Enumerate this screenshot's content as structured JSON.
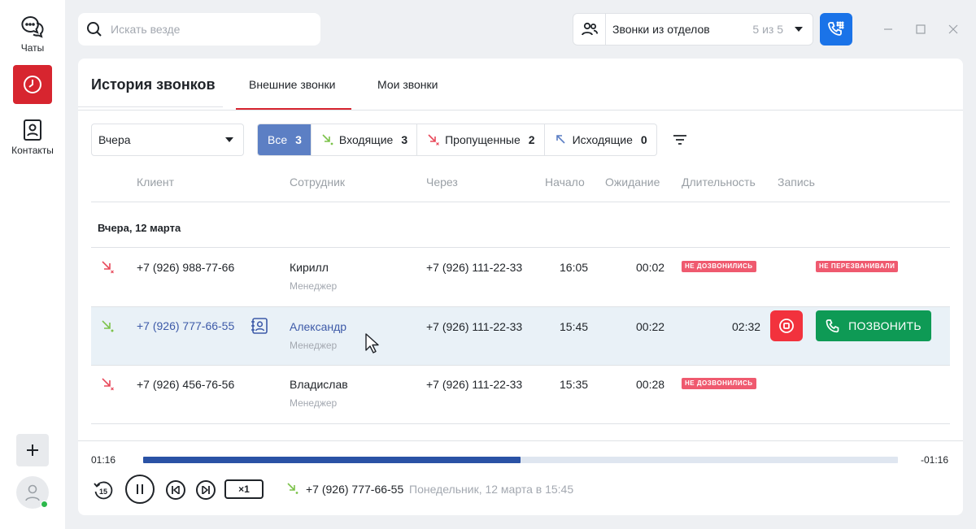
{
  "rail": {
    "chats_label": "Чаты",
    "contacts_label": "Контакты"
  },
  "search": {
    "placeholder": "Искать везде"
  },
  "departments": {
    "label": "Звонки из отделов",
    "count": "5 из 5"
  },
  "page": {
    "title": "История звонков",
    "tabs": [
      {
        "label": "Внешние звонки",
        "active": true
      },
      {
        "label": "Мои звонки",
        "active": false
      }
    ]
  },
  "filters": {
    "period": "Вчера",
    "types": [
      {
        "label": "Все",
        "count": "3",
        "active": true
      },
      {
        "label": "Входящие",
        "count": "3",
        "icon": "incoming-arrow-icon"
      },
      {
        "label": "Пропущенные",
        "count": "2",
        "icon": "missed-arrow-icon"
      },
      {
        "label": "Исходящие",
        "count": "0",
        "icon": "outgoing-arrow-icon"
      }
    ]
  },
  "table": {
    "headers": [
      "Клиент",
      "Сотрудник",
      "Через",
      "Начало",
      "Ожидание",
      "Длительность",
      "Запись"
    ],
    "group_label": "Вчера, 12 марта",
    "rows": [
      {
        "type": "missed",
        "client": "+7 (926) 988-77-66",
        "employee": "Кирилл",
        "role": "Менеджер",
        "via": "+7 (926) 111-22-33",
        "start": "16:05",
        "wait": "00:02",
        "duration_badge": "НЕ ДОЗВОНИЛИСЬ",
        "record_badge": "НЕ ПЕРЕЗВАНИВАЛИ"
      },
      {
        "type": "incoming",
        "client": "+7 (926) 777-66-55",
        "employee": "Александр",
        "role": "Менеджер",
        "via": "+7 (926) 111-22-33",
        "start": "15:45",
        "wait": "00:22",
        "duration": "02:32",
        "call_button": "ПОЗВОНИТЬ"
      },
      {
        "type": "missed",
        "client": "+7 (926) 456-76-56",
        "employee": "Владислав",
        "role": "Менеджер",
        "via": "+7 (926) 111-22-33",
        "start": "15:35",
        "wait": "00:28",
        "duration_badge": "НЕ ДОЗВОНИЛИСЬ"
      }
    ]
  },
  "player": {
    "elapsed": "01:16",
    "remaining": "-01:16",
    "progress": 0.5,
    "speed": "×1",
    "number": "+7 (926) 777-66-55",
    "date": "Понедельник, 12 марта в 15:45"
  },
  "colors": {
    "accent_red": "#d7252f",
    "blue": "#1a73e8",
    "green": "#0e9a55",
    "badge": "#ef5a6f",
    "filter_active": "#5c7fc4",
    "progress": "#2a52a5"
  }
}
